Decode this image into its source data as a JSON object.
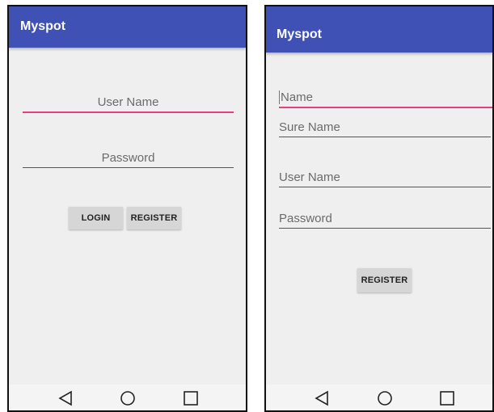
{
  "login_screen": {
    "app_title": "Myspot",
    "username_placeholder": "User Name",
    "password_placeholder": "Password",
    "login_label": "LOGIN",
    "register_label": "REGISTER"
  },
  "register_screen": {
    "app_title": "Myspot",
    "name_placeholder": "Name",
    "surename_placeholder": "Sure Name",
    "username_placeholder": "User Name",
    "password_placeholder": "Password",
    "register_label": "REGISTER"
  },
  "nav": {
    "back_icon": "back-triangle-icon",
    "home_icon": "home-circle-icon",
    "recents_icon": "recents-square-icon"
  },
  "colors": {
    "app_bar": "#3f51b5",
    "focus_accent": "#e4407d",
    "background": "#efefef",
    "button": "#d6d6d6"
  }
}
